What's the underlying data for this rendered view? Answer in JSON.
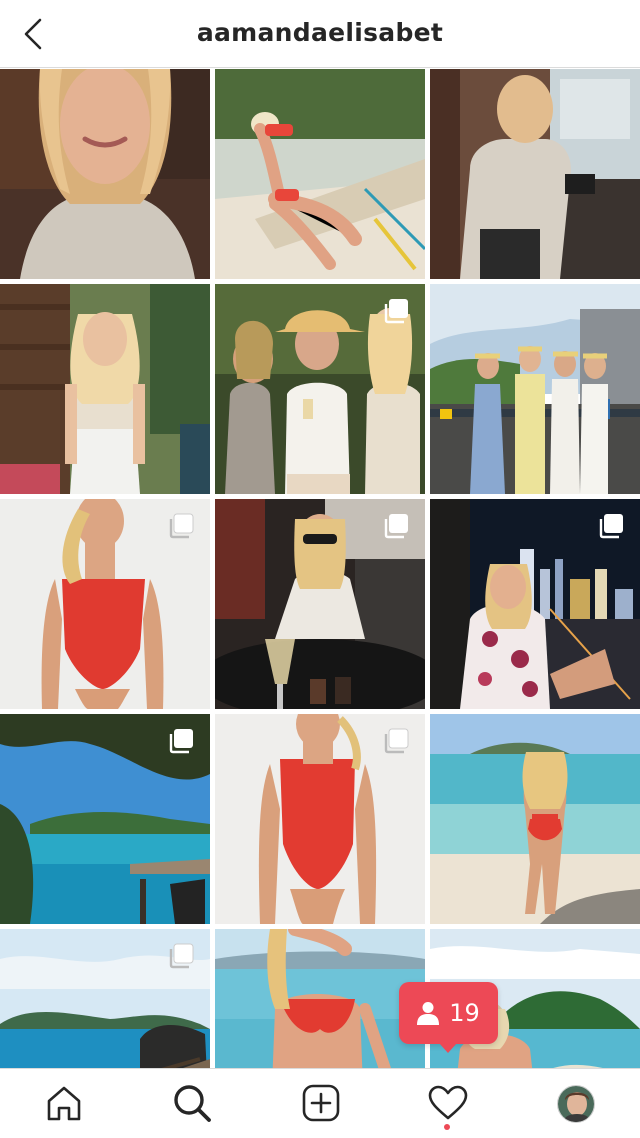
{
  "header": {
    "username": "aamandaelisabet",
    "back_icon": "chevron-left-icon"
  },
  "grid": {
    "posts": [
      {
        "id": "post-1",
        "subject": "woman-satin-blouse-closeup",
        "multi": false
      },
      {
        "id": "post-2",
        "subject": "woman-red-bikini-boat",
        "multi": false
      },
      {
        "id": "post-3",
        "subject": "woman-satin-blouse-balcony",
        "multi": false
      },
      {
        "id": "post-4",
        "subject": "woman-lace-top-cabin",
        "multi": false
      },
      {
        "id": "post-5",
        "subject": "three-friends-cowboy-hat",
        "multi": true
      },
      {
        "id": "post-6",
        "subject": "group-flower-crowns-terrace",
        "multi": false
      },
      {
        "id": "post-7",
        "subject": "woman-red-swimsuit-white-wall",
        "multi": true
      },
      {
        "id": "post-8",
        "subject": "woman-sunglasses-wine",
        "multi": true
      },
      {
        "id": "post-9",
        "subject": "woman-night-city-view",
        "multi": true
      },
      {
        "id": "post-10",
        "subject": "tropical-bay-view",
        "multi": true
      },
      {
        "id": "post-11",
        "subject": "woman-red-swimsuit-pose",
        "multi": true
      },
      {
        "id": "post-12",
        "subject": "woman-beach-shallow-water",
        "multi": false
      },
      {
        "id": "post-13",
        "subject": "rocky-coast-boardwalk",
        "multi": true
      },
      {
        "id": "post-14",
        "subject": "woman-red-bikini-sea",
        "multi": false
      },
      {
        "id": "post-15",
        "subject": "woman-island-viewpoint",
        "multi": false
      }
    ]
  },
  "notification": {
    "icon": "person-icon",
    "count": "19",
    "color": "#ed4956"
  },
  "tabbar": {
    "items": [
      {
        "name": "home",
        "icon": "home-icon"
      },
      {
        "name": "search",
        "icon": "search-icon",
        "active": true
      },
      {
        "name": "new-post",
        "icon": "plus-square-icon"
      },
      {
        "name": "activity",
        "icon": "heart-icon",
        "has_dot": true
      },
      {
        "name": "profile",
        "icon": "avatar"
      }
    ]
  }
}
